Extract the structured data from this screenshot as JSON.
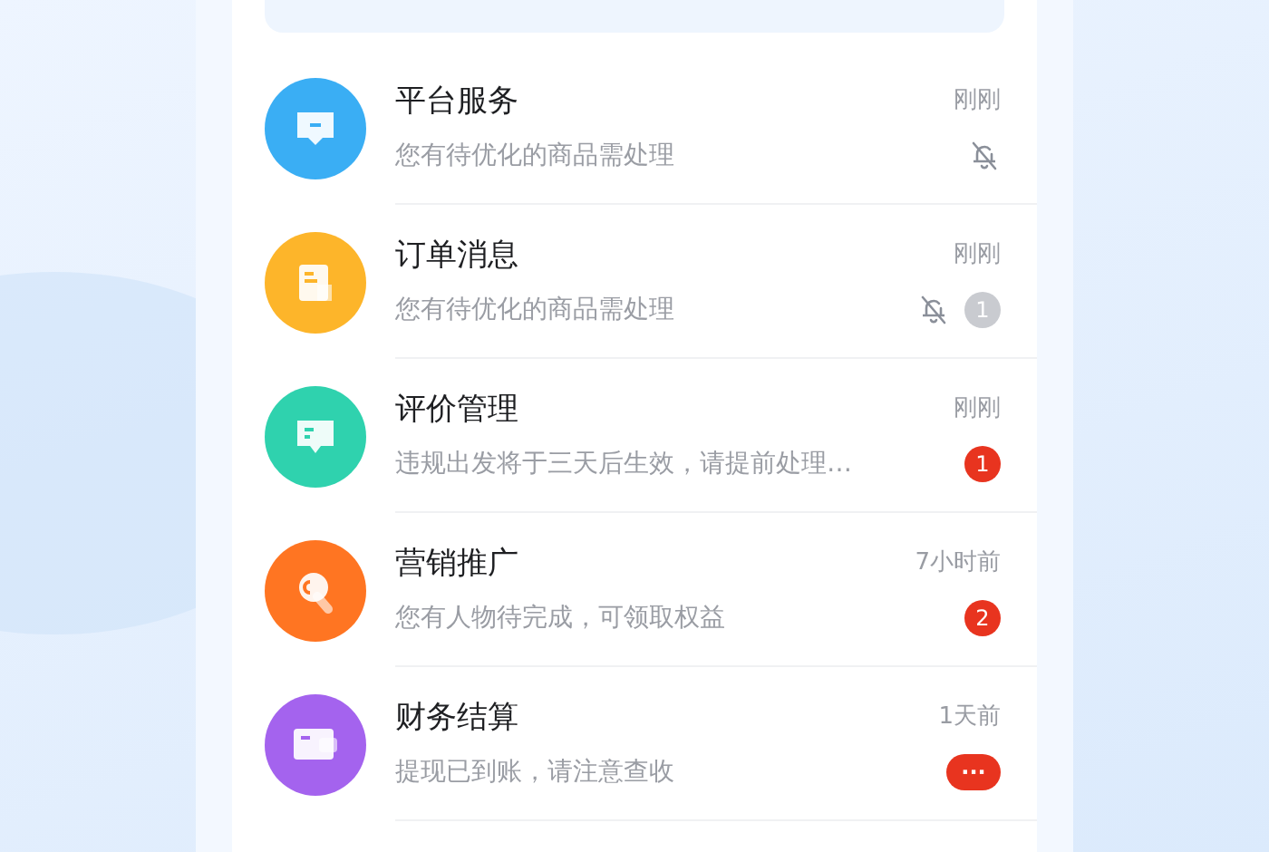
{
  "messages": [
    {
      "title": "平台服务",
      "preview": "您有待优化的商品需处理",
      "time": "刚刚",
      "color": "#3aaef4",
      "muted": true
    },
    {
      "title": "订单消息",
      "preview": "您有待优化的商品需处理",
      "time": "刚刚",
      "color": "#fdb52a",
      "muted": true,
      "badge": {
        "kind": "count",
        "text": "1"
      }
    },
    {
      "title": "评价管理",
      "preview": "违规出发将于三天后生效，请提前处理…",
      "time": "刚刚",
      "color": "#2fd2ae",
      "muted": false,
      "badge": {
        "kind": "count",
        "text": "1"
      }
    },
    {
      "title": "营销推广",
      "preview": "您有人物待完成，可领取权益",
      "time": "7小时前",
      "color": "#ff7522",
      "muted": false,
      "badge": {
        "kind": "count",
        "text": "2"
      }
    },
    {
      "title": "财务结算",
      "preview": "提现已到账，请注意查收",
      "time": "1天前",
      "color": "#a463ee",
      "muted": false,
      "badge": {
        "kind": "more",
        "text": "···"
      }
    }
  ]
}
